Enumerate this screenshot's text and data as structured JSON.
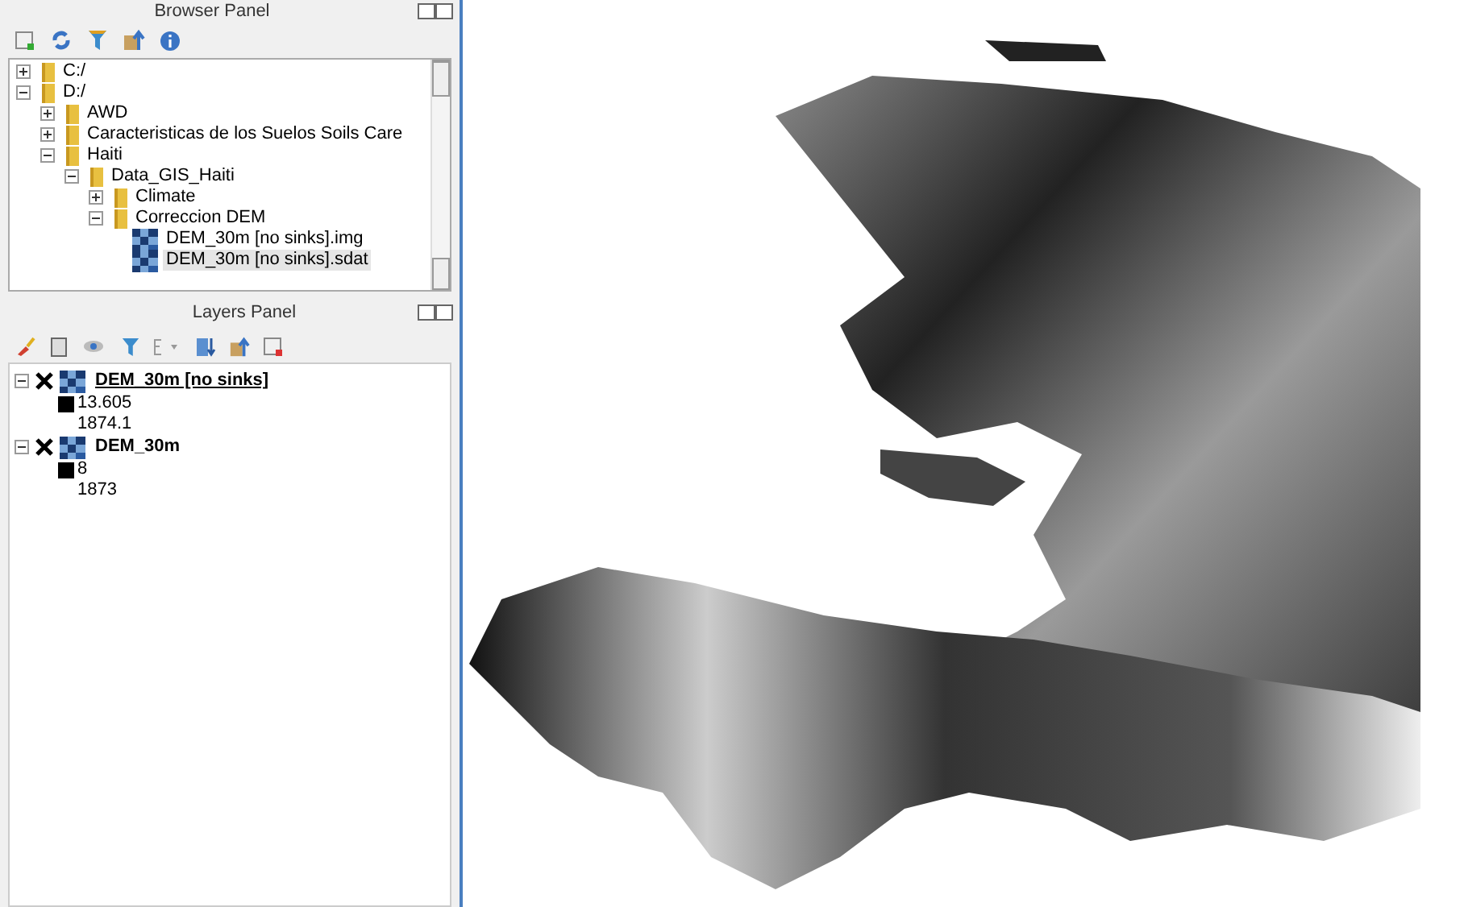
{
  "browser_panel": {
    "title": "Browser Panel",
    "tree": [
      {
        "label": "C:/",
        "kind": "folder",
        "expanded": false,
        "selected": false
      },
      {
        "label": "D:/",
        "kind": "folder",
        "expanded": true,
        "selected": false,
        "children": [
          {
            "label": "AWD",
            "kind": "folder",
            "expanded": false,
            "selected": false
          },
          {
            "label": "Caracteristicas de los Suelos Soils Care",
            "kind": "folder",
            "expanded": false,
            "selected": false
          },
          {
            "label": "Haiti",
            "kind": "folder",
            "expanded": true,
            "selected": false,
            "children": [
              {
                "label": "Data_GIS_Haiti",
                "kind": "folder",
                "expanded": true,
                "selected": false,
                "children": [
                  {
                    "label": "Climate",
                    "kind": "folder",
                    "expanded": false,
                    "selected": false
                  },
                  {
                    "label": "Correccion DEM",
                    "kind": "folder",
                    "expanded": true,
                    "selected": false,
                    "children": [
                      {
                        "label": "DEM_30m [no sinks].img",
                        "kind": "raster",
                        "selected": false
                      },
                      {
                        "label": "DEM_30m [no sinks].sdat",
                        "kind": "raster",
                        "selected": true
                      }
                    ]
                  }
                ]
              }
            ]
          }
        ]
      }
    ]
  },
  "layers_panel": {
    "title": "Layers Panel",
    "layers": [
      {
        "name": "DEM_30m [no sinks]",
        "checked": true,
        "expanded": true,
        "selected": true,
        "legend": [
          "13.605",
          "1874.1"
        ]
      },
      {
        "name": "DEM_30m",
        "checked": true,
        "expanded": true,
        "selected": false,
        "legend": [
          "8",
          "1873"
        ]
      }
    ]
  }
}
